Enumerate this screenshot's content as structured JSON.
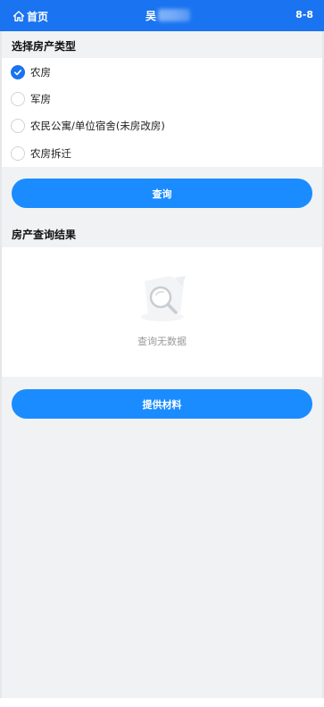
{
  "header": {
    "home_label": "首页",
    "title_visible": "吴",
    "version": "8-8"
  },
  "house_type": {
    "section_title": "选择房产类型",
    "options": [
      {
        "label": "农房",
        "checked": true
      },
      {
        "label": "军房",
        "checked": false
      },
      {
        "label": "农民公寓/单位宿舍(未房改房)",
        "checked": false
      },
      {
        "label": "农房拆迁",
        "checked": false
      }
    ]
  },
  "query_button": {
    "label": "查询"
  },
  "result": {
    "section_title": "房产查询结果",
    "empty_text": "查询无数据",
    "empty_icon": "magnifier-icon"
  },
  "submit_button": {
    "label": "提供材料"
  },
  "colors": {
    "header_bg": "#1a73f0",
    "button_bg": "#1a8cff",
    "page_bg": "#f1f2f4"
  }
}
